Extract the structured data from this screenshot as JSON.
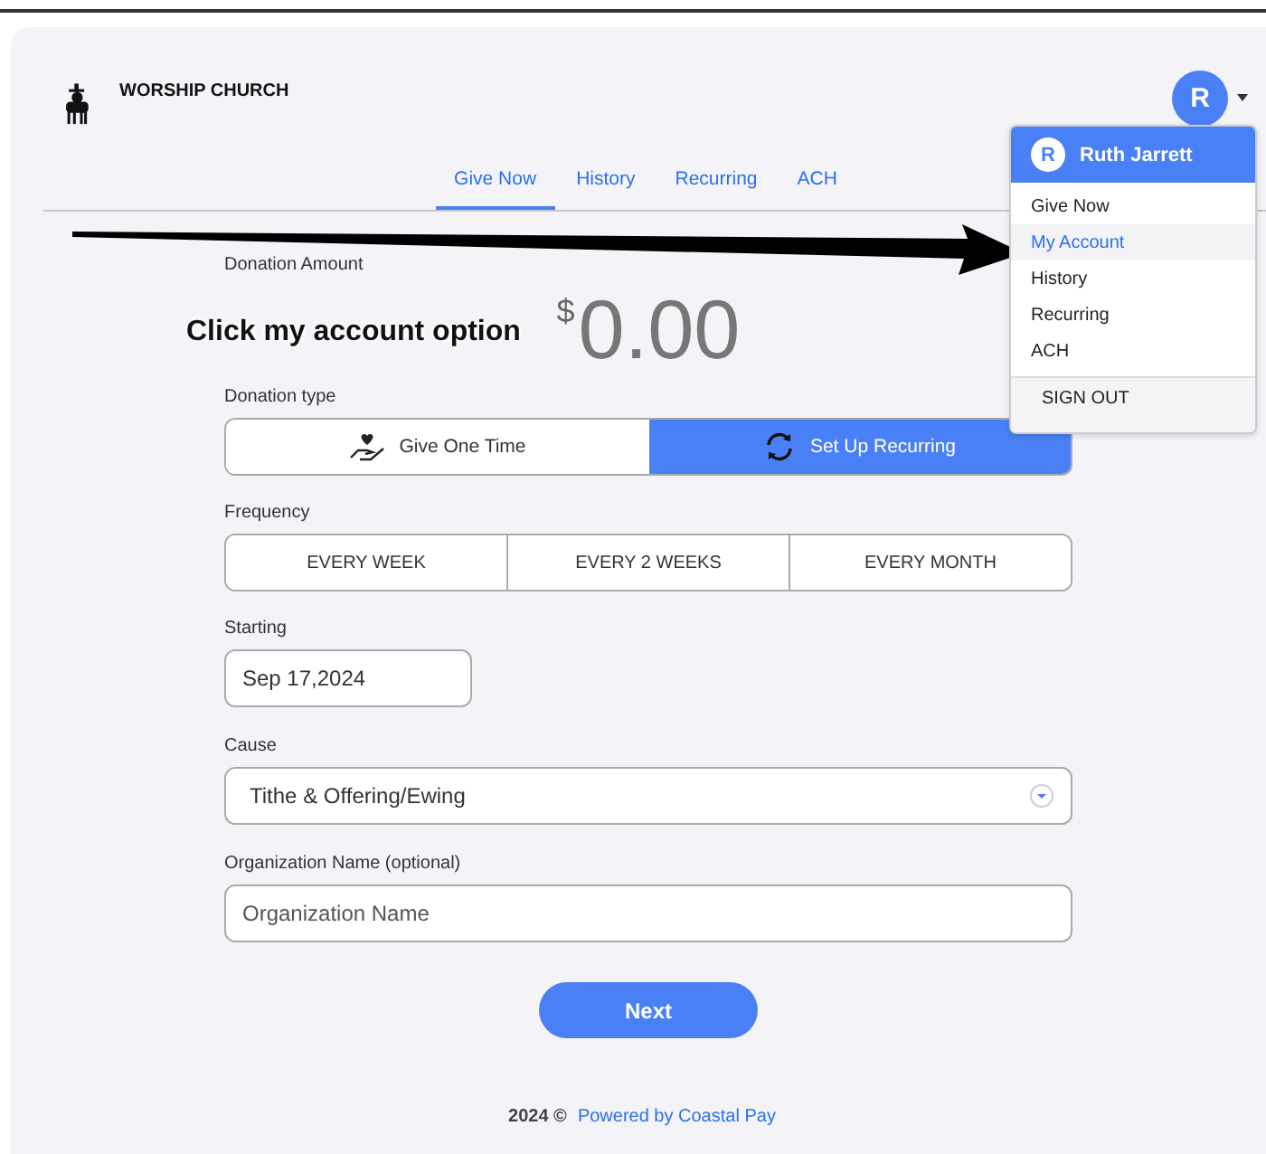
{
  "header": {
    "org_name": "WORSHIP CHURCH",
    "avatar_initial": "R"
  },
  "tabs": [
    {
      "label": "Give Now",
      "selected": true
    },
    {
      "label": "History",
      "selected": false
    },
    {
      "label": "Recurring",
      "selected": false
    },
    {
      "label": "ACH",
      "selected": false
    }
  ],
  "user_menu": {
    "avatar_initial": "R",
    "name": "Ruth Jarrett",
    "items": [
      {
        "label": "Give Now",
        "selected": false
      },
      {
        "label": "My Account",
        "selected": true
      },
      {
        "label": "History",
        "selected": false
      },
      {
        "label": "Recurring",
        "selected": false
      },
      {
        "label": "ACH",
        "selected": false
      }
    ],
    "sign_out": "SIGN OUT"
  },
  "form": {
    "amount_label": "Donation Amount",
    "currency": "$",
    "amount": "0.00",
    "donation_type_label": "Donation type",
    "donation_types": [
      {
        "kind": "one-time",
        "label": "Give One Time",
        "selected": false
      },
      {
        "kind": "recurring",
        "label": "Set Up Recurring",
        "selected": true
      }
    ],
    "frequency_label": "Frequency",
    "frequencies": [
      {
        "label": "EVERY WEEK",
        "selected": false
      },
      {
        "label": "EVERY 2 WEEKS",
        "selected": false
      },
      {
        "label": "EVERY MONTH",
        "selected": false
      }
    ],
    "starting_label": "Starting",
    "starting_value": "Sep 17,2024",
    "cause_label": "Cause",
    "cause_value": "Tithe & Offering/Ewing",
    "org_name_label": "Organization Name (optional)",
    "org_name_placeholder": "Organization Name",
    "next_button": "Next"
  },
  "footer": {
    "copyright": "2024 ©",
    "link": "Powered by Coastal Pay"
  },
  "annotation": {
    "text": "Click my account option"
  }
}
